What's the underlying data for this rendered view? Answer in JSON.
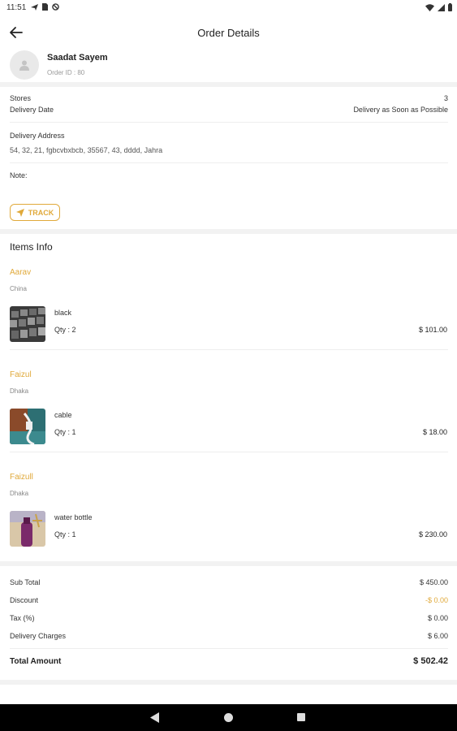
{
  "status_bar": {
    "time": "11:51"
  },
  "header": {
    "title": "Order Details"
  },
  "customer": {
    "name": "Saadat Sayem",
    "order_id": "Order ID : 80"
  },
  "order_info": {
    "stores_label": "Stores",
    "stores_value": "3",
    "delivery_date_label": "Delivery Date",
    "delivery_date_value": "Delivery as Soon as Possible",
    "address_label": "Delivery Address",
    "address_value": "54, 32, 21, fgbcvbxbcb, 35567, 43, dddd, Jahra",
    "note_label": "Note:",
    "track_label": "TRACK"
  },
  "items_info": {
    "title": "Items Info",
    "stores": [
      {
        "store": "Aarav",
        "city": "China",
        "item": "black",
        "qty": "Qty : 2",
        "price": "$ 101.00"
      },
      {
        "store": "Faizul",
        "city": "Dhaka",
        "item": "cable",
        "qty": "Qty : 1",
        "price": "$ 18.00"
      },
      {
        "store": "Faizull",
        "city": "Dhaka",
        "item": "water bottle",
        "qty": "Qty : 1",
        "price": "$ 230.00"
      }
    ]
  },
  "summary": {
    "subtotal_label": "Sub Total",
    "subtotal_value": "$ 450.00",
    "discount_label": "Discount",
    "discount_value": "-$ 0.00",
    "tax_label": "Tax (%)",
    "tax_value": "$ 0.00",
    "delivery_label": "Delivery Charges",
    "delivery_value": "$ 6.00",
    "total_label": "Total Amount",
    "total_value": "$ 502.42"
  },
  "colors": {
    "accent": "#e0a93a",
    "separator": "#f2f2f2",
    "nav_bg": "#000000"
  },
  "icons": [
    "back-arrow-icon",
    "avatar-placeholder-icon",
    "navigation-arrow-icon",
    "wifi-icon",
    "signal-icon",
    "battery-icon"
  ]
}
